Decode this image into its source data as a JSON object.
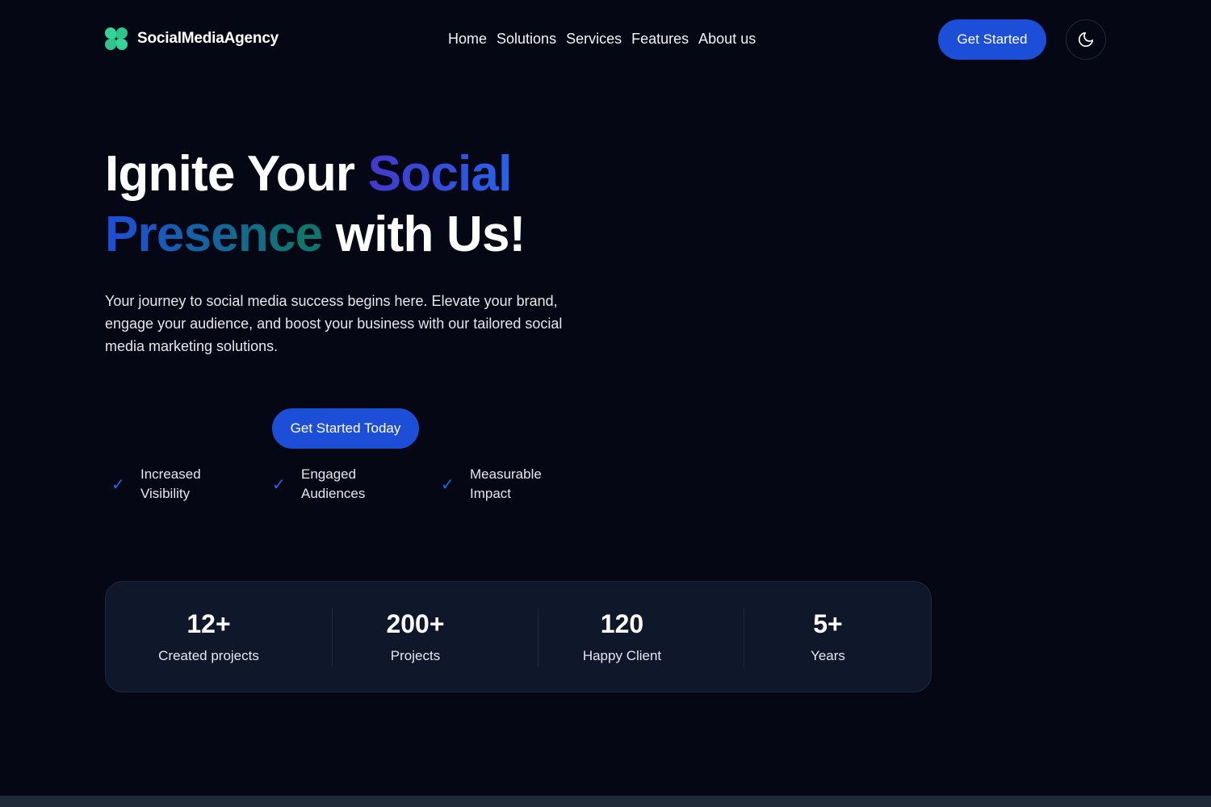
{
  "header": {
    "brand_name": "SocialMediaAgency",
    "nav": [
      "Home",
      "Solutions",
      "Services",
      "Features",
      "About us"
    ],
    "cta_label": "Get Started",
    "theme_toggle_icon": "moon-icon"
  },
  "hero": {
    "title_part1": "Ignite Your ",
    "title_highlight1": "Social",
    "title_highlight2": "Presence",
    "title_part2": " with Us!",
    "subtitle": "Your journey to social media success begins here. Elevate your brand, engage your audience, and boost your business with our tailored social media marketing solutions.",
    "cta_label": "Get Started Today",
    "benefits": [
      {
        "label": "Increased Visibility"
      },
      {
        "label": "Engaged Audiences"
      },
      {
        "label": "Measurable Impact"
      }
    ]
  },
  "stats": [
    {
      "value": "12+",
      "label": "Created projects"
    },
    {
      "value": "200+",
      "label": "Projects"
    },
    {
      "value": "120",
      "label": "Happy Client"
    },
    {
      "value": "5+",
      "label": "Years"
    }
  ],
  "colors": {
    "background": "#050814",
    "accent": "#1d4ed8",
    "logo": "#34d399",
    "card": "#0f172a"
  }
}
